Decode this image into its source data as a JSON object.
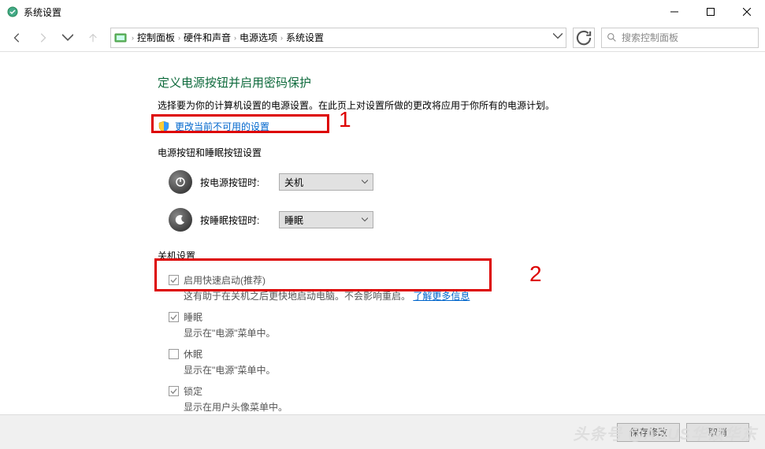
{
  "window": {
    "title": "系统设置"
  },
  "nav": {
    "crumbs": [
      "控制面板",
      "硬件和声音",
      "电源选项",
      "系统设置"
    ],
    "search_placeholder": "搜索控制面板"
  },
  "main": {
    "heading": "定义电源按钮并启用密码保护",
    "subtext": "选择要为你的计算机设置的电源设置。在此页上对设置所做的更改将应用于你所有的电源计划。",
    "change_unavailable": "更改当前不可用的设置",
    "section_buttons": "电源按钮和睡眠按钮设置",
    "power_button": {
      "label": "按电源按钮时:",
      "value": "关机"
    },
    "sleep_button": {
      "label": "按睡眠按钮时:",
      "value": "睡眠"
    },
    "section_shutdown": "关机设置",
    "fast_startup": {
      "label": "启用快速启动(推荐)",
      "desc": "这有助于在关机之后更快地启动电脑。不会影响重启。",
      "learn": "了解更多信息",
      "checked": true
    },
    "sleep": {
      "label": "睡眠",
      "desc": "显示在\"电源\"菜单中。",
      "checked": true
    },
    "hibernate": {
      "label": "休眠",
      "desc": "显示在\"电源\"菜单中。",
      "checked": false
    },
    "lock": {
      "label": "锁定",
      "desc": "显示在用户头像菜单中。",
      "checked": true
    }
  },
  "footer": {
    "save": "保存修改",
    "cancel": "取消"
  },
  "annotations": {
    "one": "1",
    "two": "2"
  },
  "watermark": "头条号 @ASUS华硕华东"
}
